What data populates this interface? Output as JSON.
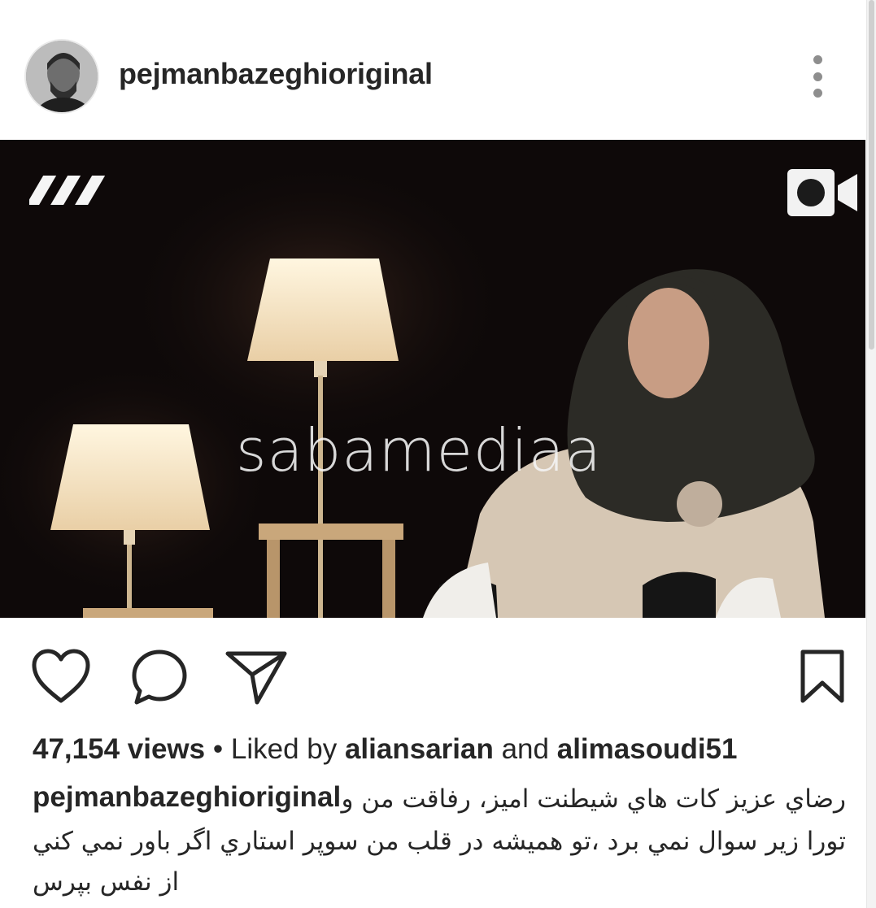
{
  "header": {
    "username": "pejmanbazeghioriginal"
  },
  "media": {
    "watermark": "sabamediaa"
  },
  "stats": {
    "views": "47,154 views",
    "separator": "•",
    "liked_by_prefix": "Liked by",
    "liker_1": "aliansarian",
    "conjunction": "and",
    "liker_2": "alimasoudi51"
  },
  "caption": {
    "username": "pejmanbazeghioriginal",
    "line1": "رضاي عزيز كات هاي شيطنت اميز، رفاقت من و",
    "line2": "تورا زير سوال نمي برد ،تو هميشه در قلب من سوپر استاري اگر باور نمي كني",
    "line3": "از نفس بپرس"
  },
  "icons": {
    "more": "more-options-icon",
    "video": "video-camera-icon",
    "like": "heart-icon",
    "comment": "comment-icon",
    "share": "direct-share-icon",
    "save": "bookmark-icon",
    "channel": "tv-channel-logo"
  }
}
